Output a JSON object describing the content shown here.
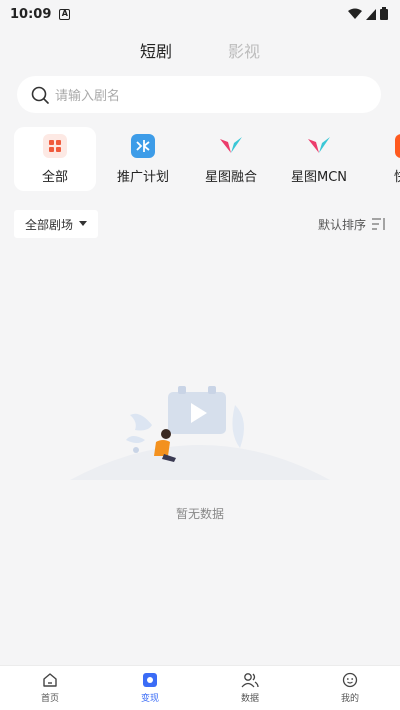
{
  "status_bar": {
    "time": "10:09",
    "notif_glyph": "A"
  },
  "top_tabs": [
    {
      "label": "短剧",
      "active": true
    },
    {
      "label": "影视",
      "active": false
    }
  ],
  "search": {
    "placeholder": "请输入剧名"
  },
  "categories": [
    {
      "label": "全部",
      "icon": "grid-icon",
      "active": true
    },
    {
      "label": "推广计划",
      "icon": "plan-icon",
      "active": false
    },
    {
      "label": "星图融合",
      "icon": "xingtu-icon",
      "active": false
    },
    {
      "label": "星图MCN",
      "icon": "xingtu-mcn-icon",
      "active": false
    },
    {
      "label": "快手",
      "icon": "kuaishou-icon",
      "active": false
    }
  ],
  "filter": {
    "label": "全部剧场",
    "sort_label": "默认排序"
  },
  "empty": {
    "text": "暂无数据"
  },
  "bottom_nav": [
    {
      "label": "首页",
      "icon": "home-icon",
      "active": false
    },
    {
      "label": "变现",
      "icon": "monetize-icon",
      "active": true
    },
    {
      "label": "数据",
      "icon": "users-icon",
      "active": false
    },
    {
      "label": "我的",
      "icon": "profile-icon",
      "active": false
    }
  ],
  "colors": {
    "accent": "#3b6cf6",
    "bg": "#f5f5f6"
  }
}
